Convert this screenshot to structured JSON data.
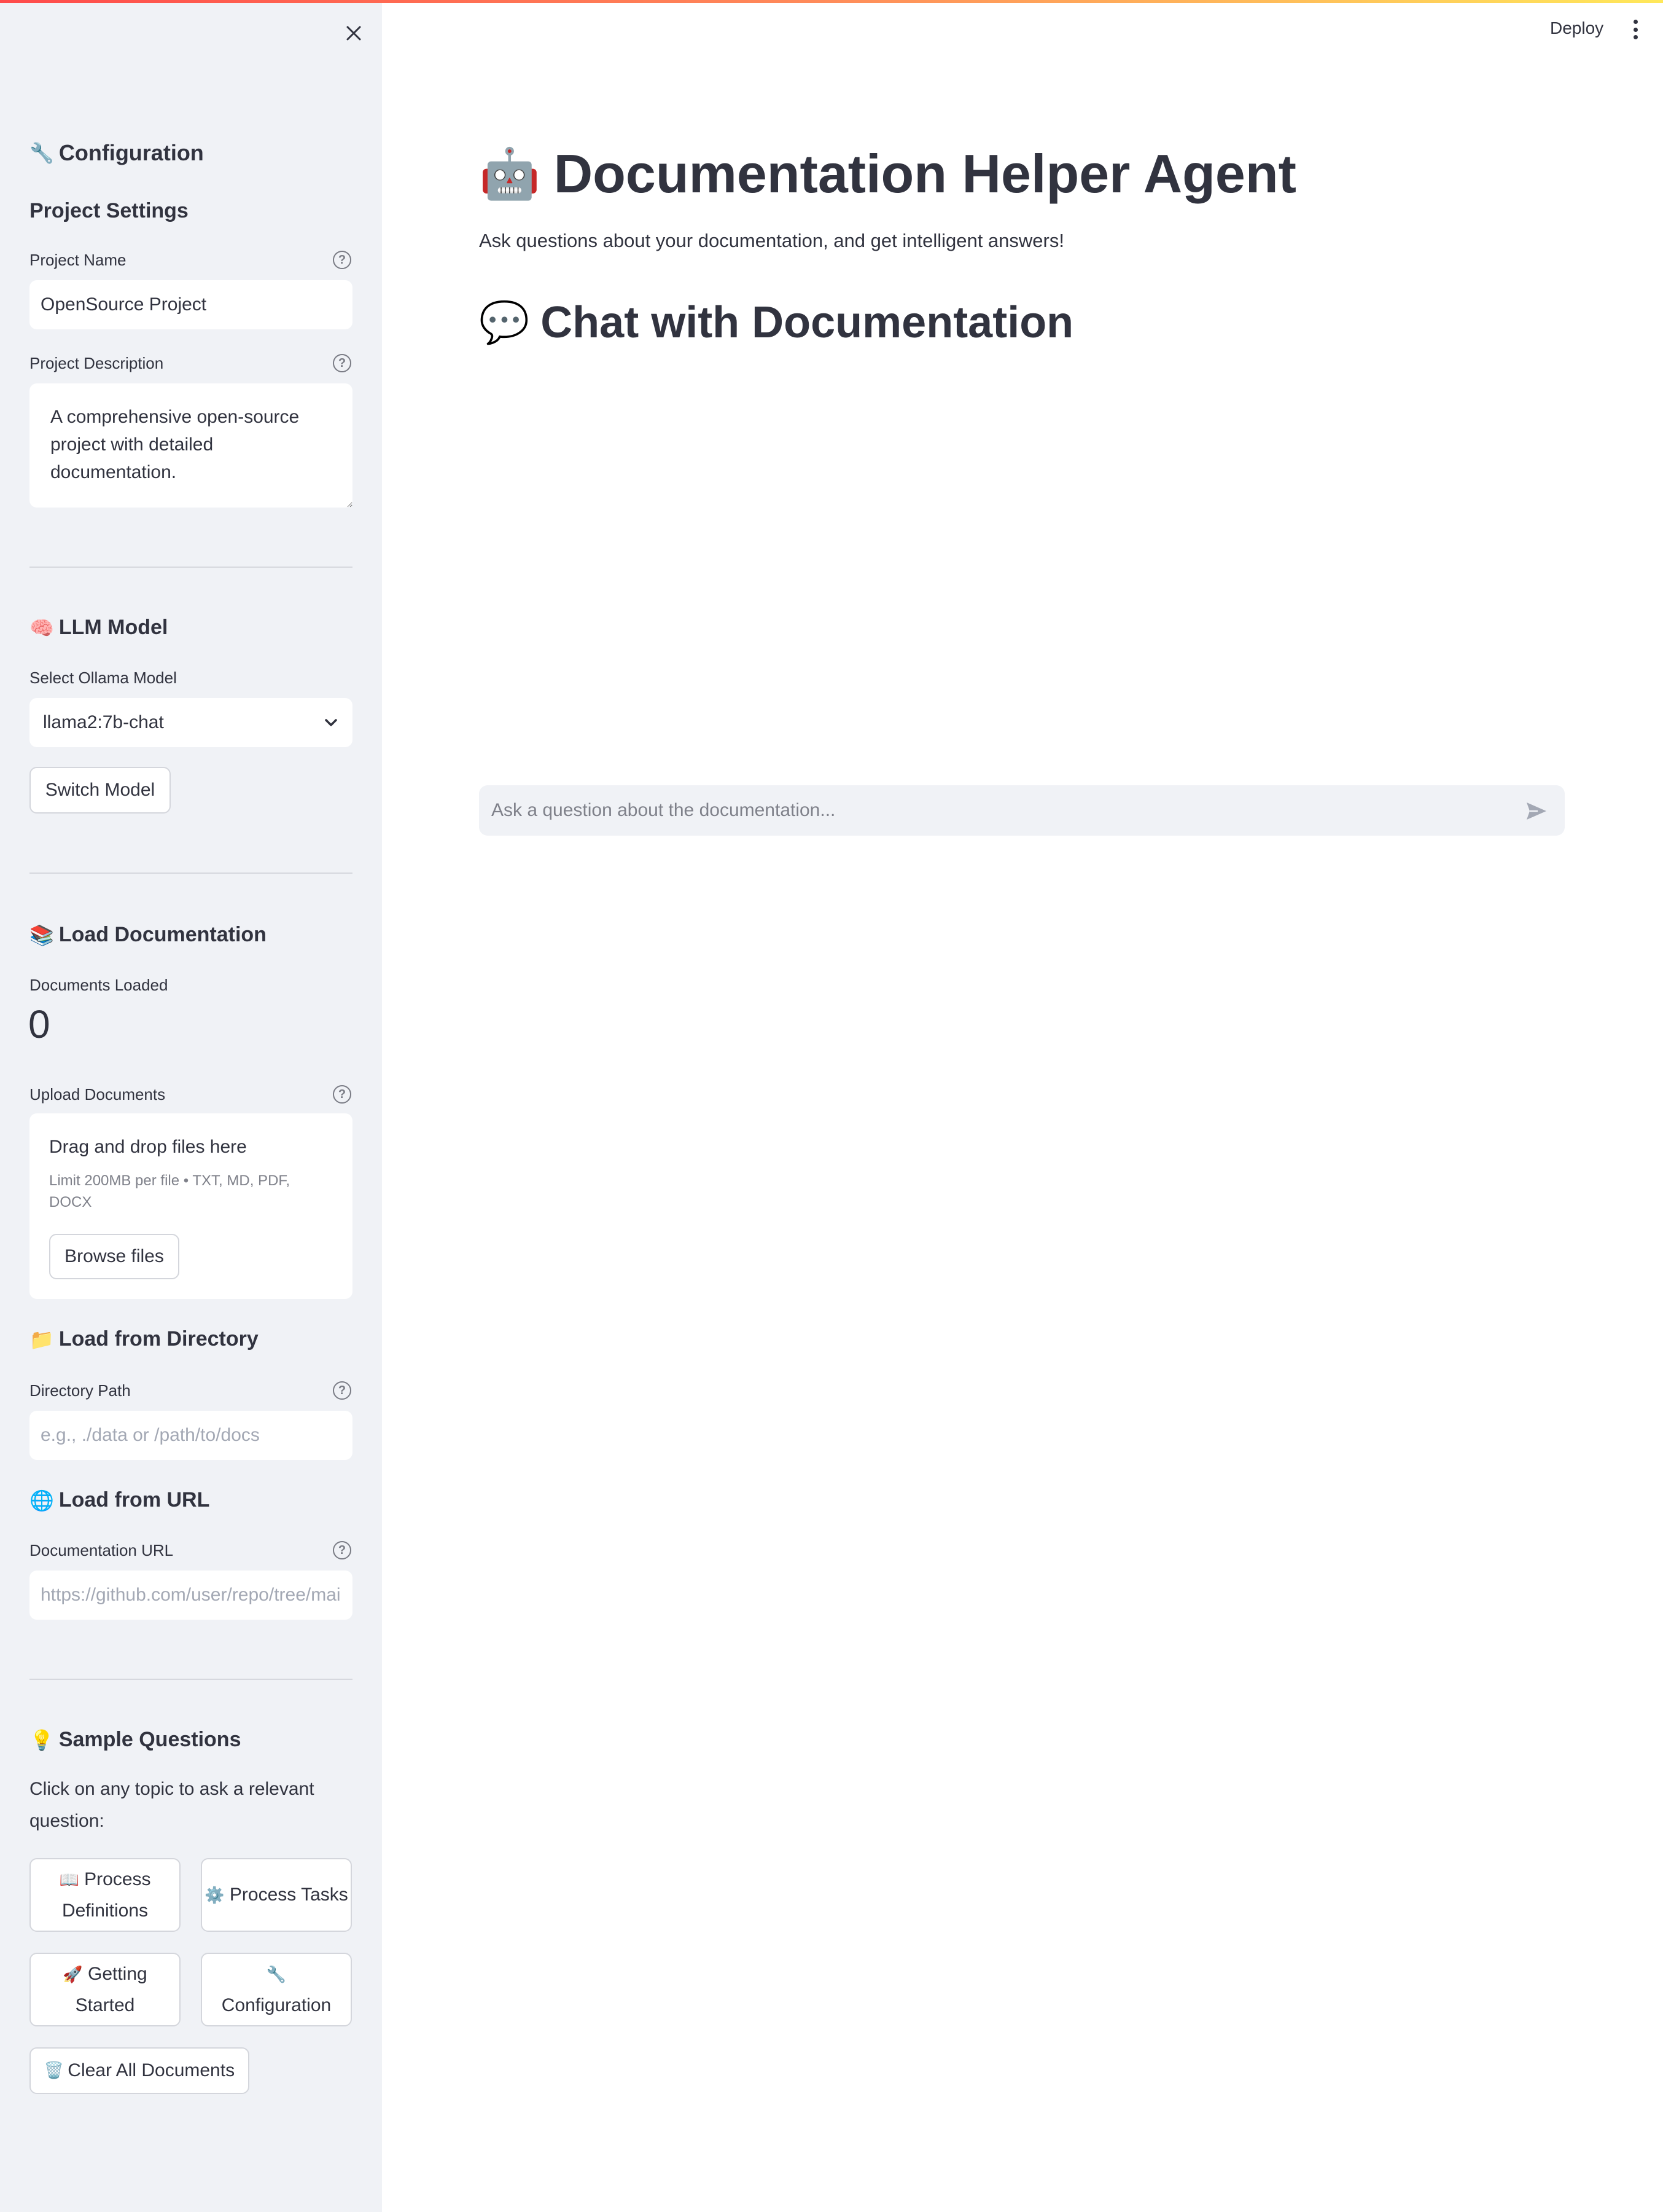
{
  "header": {
    "deploy_label": "Deploy",
    "menu_icon": "kebab-menu-icon"
  },
  "sidebar": {
    "close_icon": "close-icon",
    "configuration": {
      "icon": "🔧",
      "title": "Configuration"
    },
    "project_settings": {
      "title": "Project Settings",
      "name_label": "Project Name",
      "name_value": "OpenSource Project",
      "description_label": "Project Description",
      "description_value": "A comprehensive open-source project with detailed documentation."
    },
    "llm": {
      "icon": "🧠",
      "title": "LLM Model",
      "select_label": "Select Ollama Model",
      "selected_model": "llama2:7b-chat",
      "switch_label": "Switch Model"
    },
    "load_docs": {
      "icon": "📚",
      "title": "Load Documentation",
      "metric_label": "Documents Loaded",
      "metric_value": "0",
      "upload_label": "Upload Documents",
      "drag_text": "Drag and drop files here",
      "limit_text": "Limit 200MB per file • TXT, MD, PDF, DOCX",
      "browse_label": "Browse files"
    },
    "load_dir": {
      "icon": "📁",
      "title": "Load from Directory",
      "path_label": "Directory Path",
      "path_placeholder": "e.g., ./data or /path/to/docs"
    },
    "load_url": {
      "icon": "🌐",
      "title": "Load from URL",
      "url_label": "Documentation URL",
      "url_placeholder": "https://github.com/user/repo/tree/main/docs"
    },
    "samples": {
      "icon": "💡",
      "title": "Sample Questions",
      "intro": "Click on any topic to ask a relevant question:",
      "buttons": [
        {
          "icon": "📖",
          "label": "Process Definitions"
        },
        {
          "icon": "⚙️",
          "label": "Process Tasks"
        },
        {
          "icon": "🚀",
          "label": "Getting Started"
        },
        {
          "icon": "🔧",
          "label": "Configuration"
        }
      ],
      "clear_icon": "🗑️",
      "clear_label": "Clear All Documents"
    }
  },
  "main": {
    "title_icon": "🤖",
    "title": "Documentation Helper Agent",
    "subtitle": "Ask questions about your documentation, and get intelligent answers!",
    "chat_icon": "💬",
    "chat_title": "Chat with Documentation",
    "chat_placeholder": "Ask a question about the documentation..."
  },
  "colors": {
    "sidebar_bg": "#f0f2f6",
    "text": "#31333f",
    "accent_gradient_start": "#ff4b4b",
    "accent_gradient_end": "#ffe85a"
  }
}
